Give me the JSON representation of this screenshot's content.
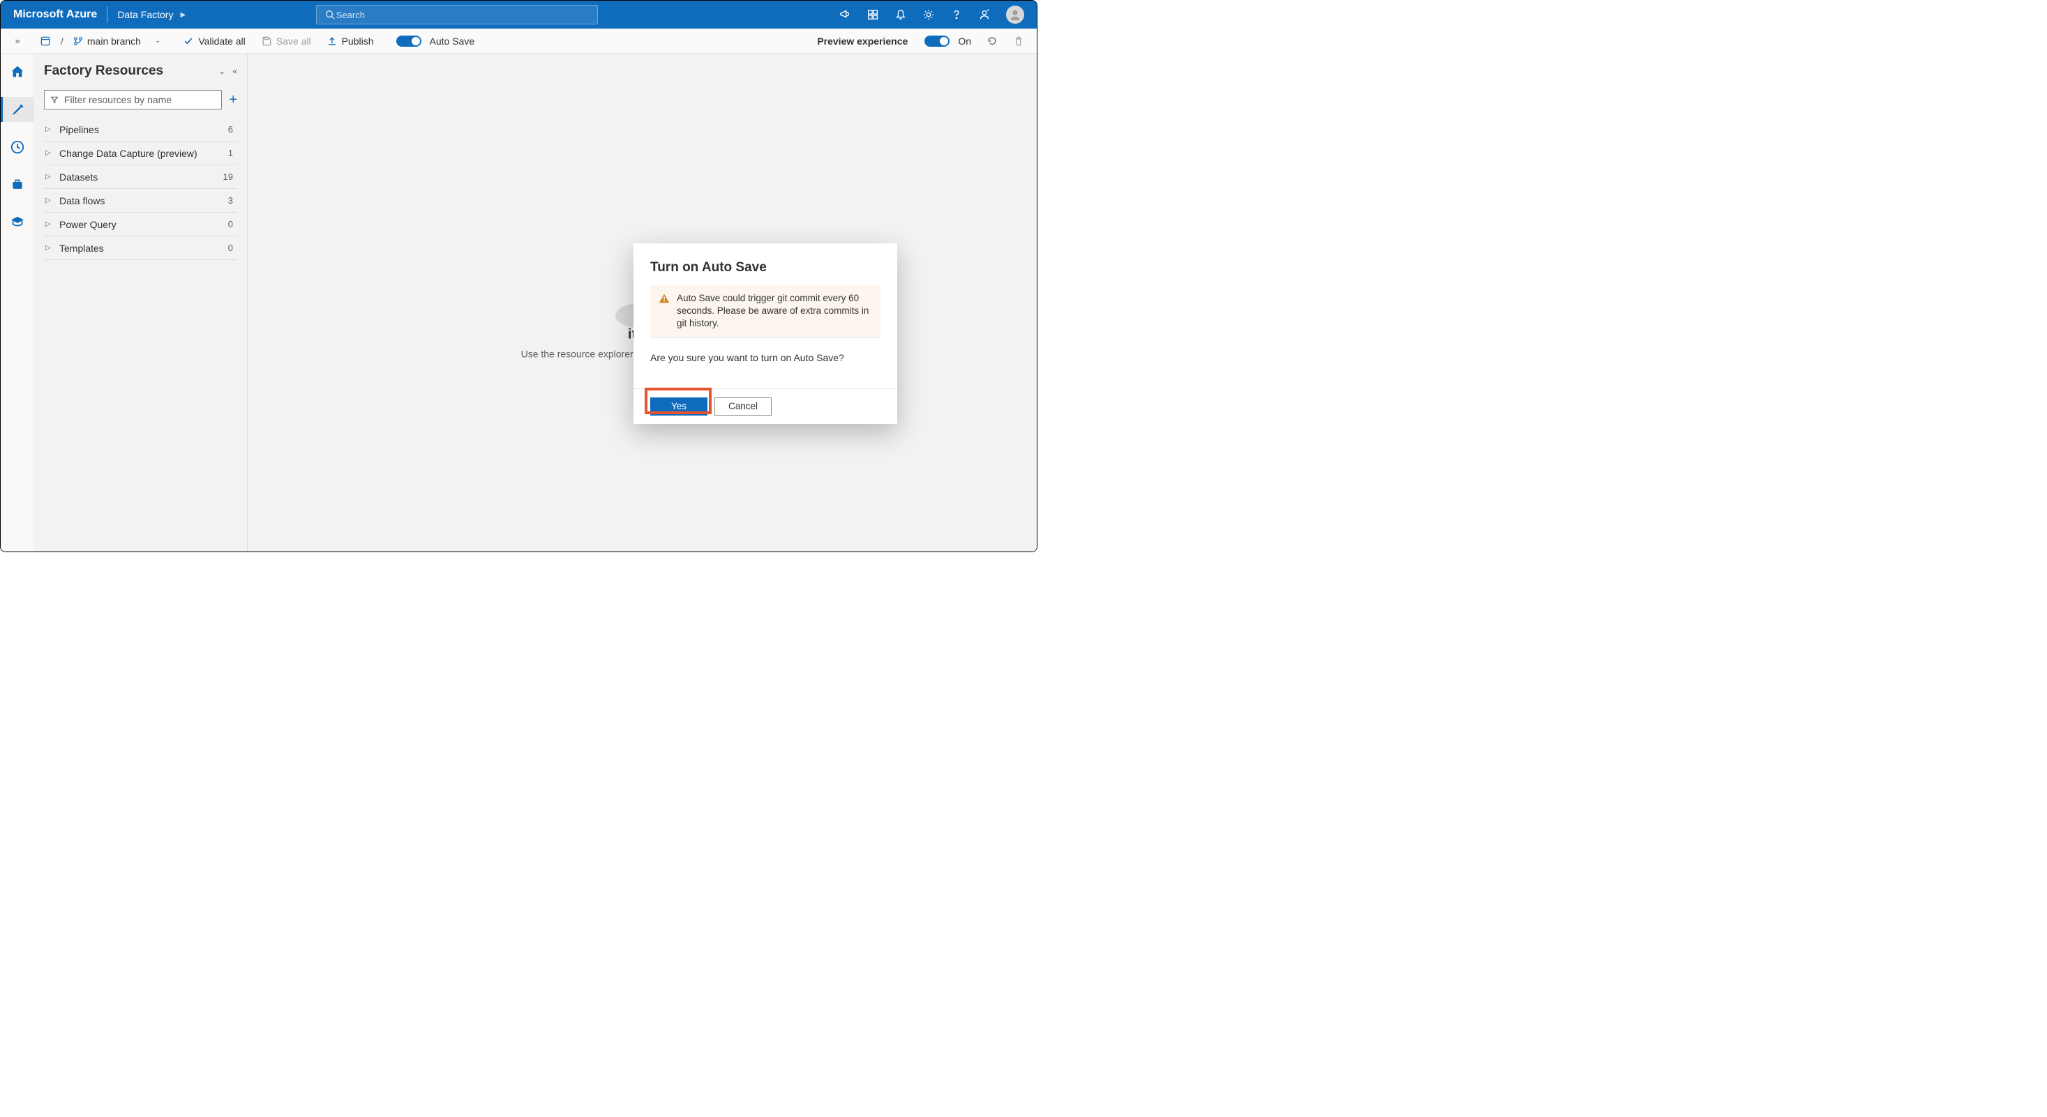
{
  "header": {
    "brand": "Microsoft Azure",
    "breadcrumb": "Data Factory",
    "search_placeholder": "Search"
  },
  "actionbar": {
    "branch": "main branch",
    "validate": "Validate all",
    "save": "Save all",
    "publish": "Publish",
    "autosave": "Auto Save",
    "preview": "Preview experience",
    "preview_state": "On"
  },
  "resources": {
    "title": "Factory Resources",
    "filter_placeholder": "Filter resources by name",
    "items": [
      {
        "label": "Pipelines",
        "count": "6"
      },
      {
        "label": "Change Data Capture (preview)",
        "count": "1"
      },
      {
        "label": "Datasets",
        "count": "19"
      },
      {
        "label": "Data flows",
        "count": "3"
      },
      {
        "label": "Power Query",
        "count": "0"
      },
      {
        "label": "Templates",
        "count": "0"
      }
    ]
  },
  "empty": {
    "heading_suffix": "item",
    "subtext": "Use the resource explorer to select or create a new item"
  },
  "modal": {
    "title": "Turn on Auto Save",
    "warning": "Auto Save could trigger git commit every 60 seconds. Please be aware of extra commits in git history.",
    "question": "Are you sure you want to turn on Auto Save?",
    "yes": "Yes",
    "cancel": "Cancel"
  }
}
